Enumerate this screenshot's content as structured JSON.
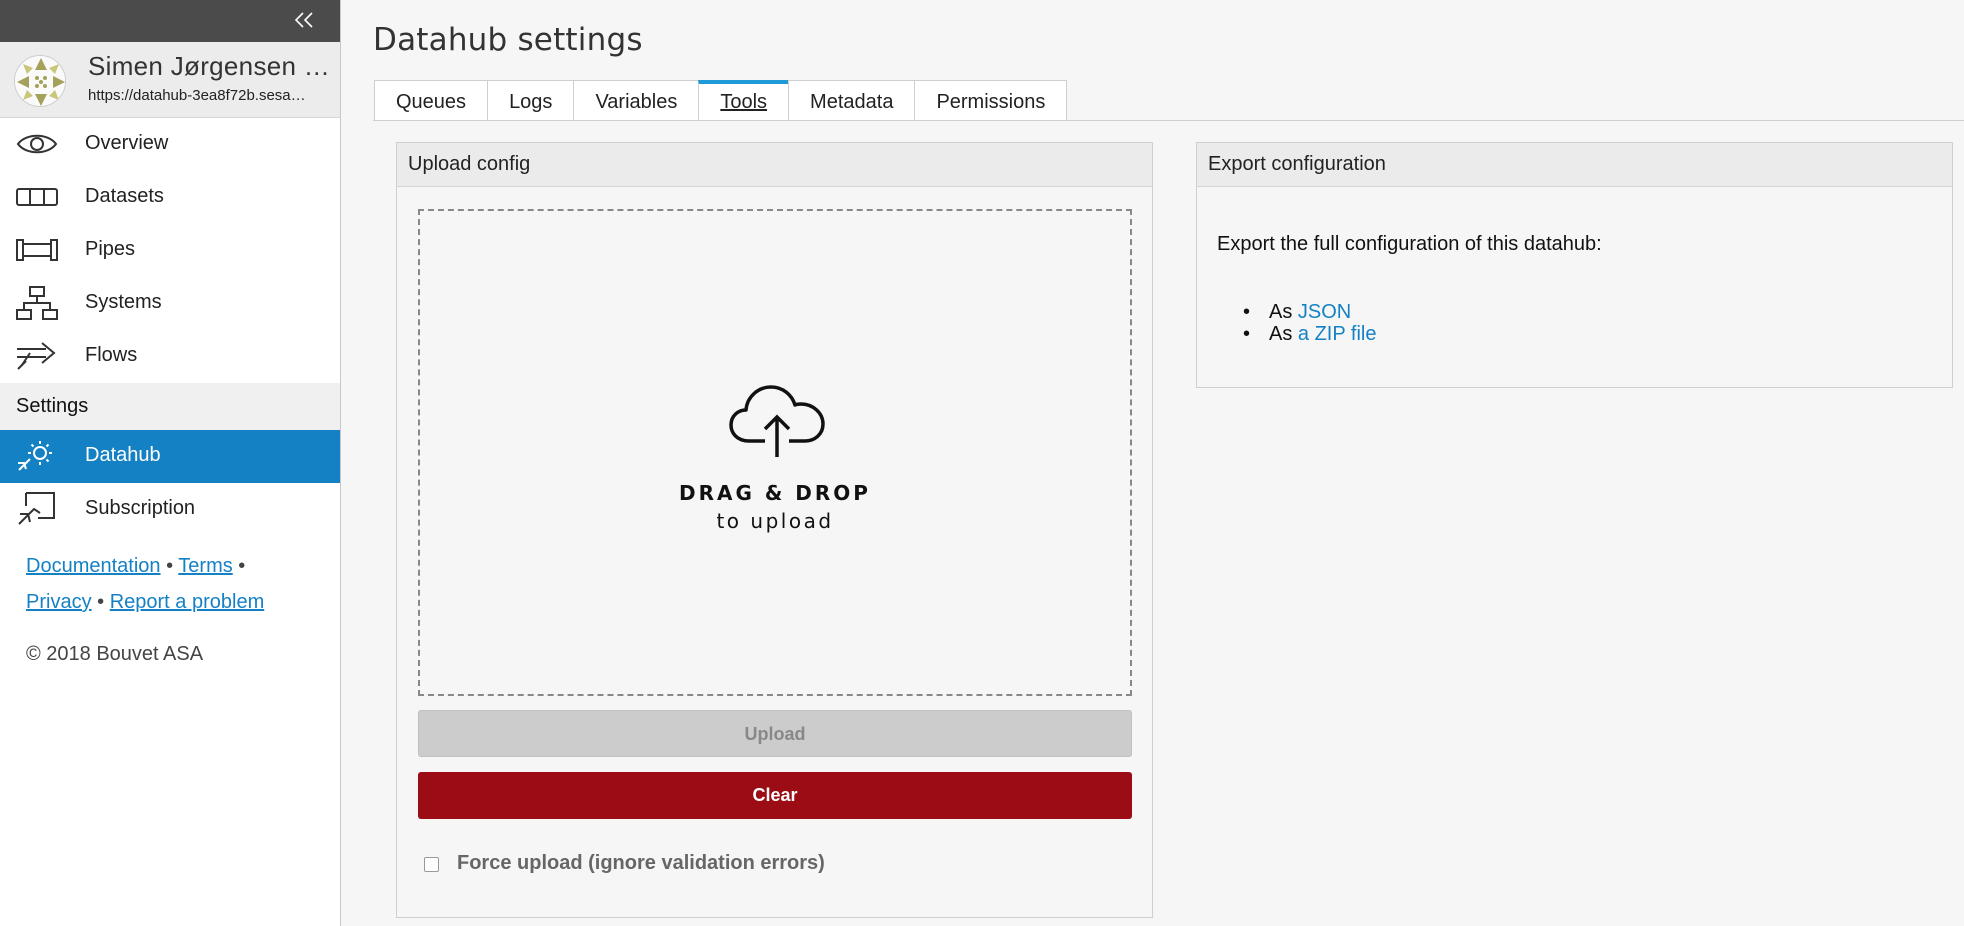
{
  "sidebar": {
    "user": {
      "name": "Simen Jørgensen …",
      "url": "https://datahub-3ea8f72b.sesa…"
    },
    "nav": [
      {
        "label": "Overview",
        "icon": "eye-icon"
      },
      {
        "label": "Datasets",
        "icon": "datasets-icon"
      },
      {
        "label": "Pipes",
        "icon": "pipe-icon"
      },
      {
        "label": "Systems",
        "icon": "systems-icon"
      },
      {
        "label": "Flows",
        "icon": "flows-icon"
      }
    ],
    "settings_header": "Settings",
    "settings_nav": [
      {
        "label": "Datahub",
        "icon": "datahub-gear-icon",
        "active": true
      },
      {
        "label": "Subscription",
        "icon": "subscription-icon"
      }
    ],
    "footer": {
      "documentation": "Documentation",
      "sep1": " • ",
      "terms": "Terms",
      "sep2": " •",
      "privacy": "Privacy",
      "sep3": " • ",
      "report": "Report a problem",
      "copyright": "© 2018 Bouvet ASA"
    },
    "colors": {
      "active": "#1581c5",
      "topbar": "#4b4b4b"
    }
  },
  "page": {
    "title": "Datahub settings",
    "tabs": [
      {
        "label": "Queues"
      },
      {
        "label": "Logs"
      },
      {
        "label": "Variables"
      },
      {
        "label": "Tools",
        "active": true
      },
      {
        "label": "Metadata"
      },
      {
        "label": "Permissions"
      }
    ]
  },
  "upload": {
    "header": "Upload config",
    "dropzone_title": "DRAG & DROP",
    "dropzone_sub": "to upload",
    "upload_button": "Upload",
    "clear_button": "Clear",
    "force_label": "Force upload (ignore validation errors)",
    "force_checked": false,
    "colors": {
      "clear": "#9b0c14",
      "upload_disabled": "#cccccc"
    }
  },
  "export": {
    "header": "Export configuration",
    "text": "Export the full configuration of this datahub:",
    "items": [
      {
        "prefix": "As ",
        "link": "JSON"
      },
      {
        "prefix": "As ",
        "link": "a ZIP file"
      }
    ]
  }
}
